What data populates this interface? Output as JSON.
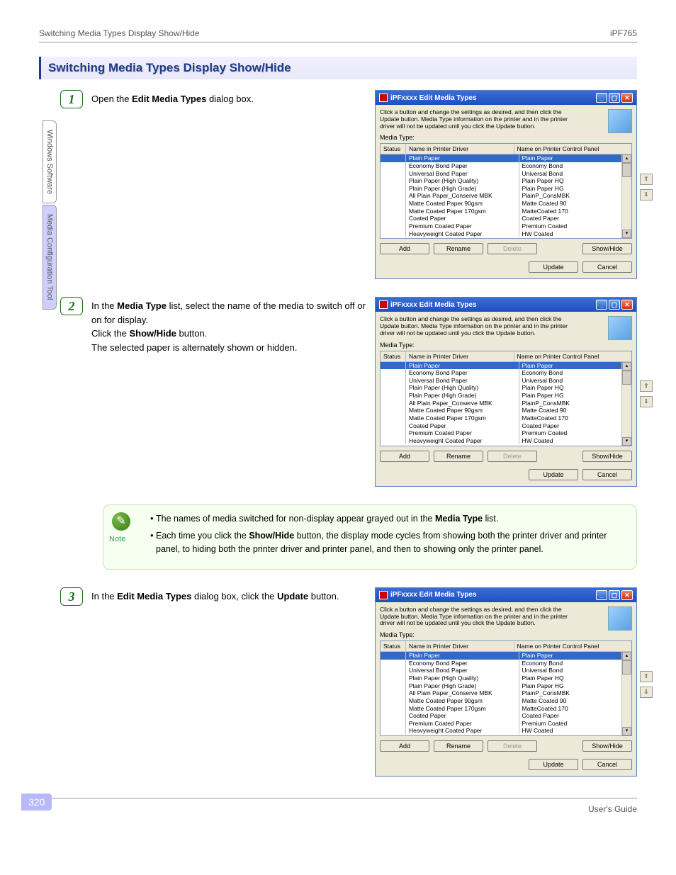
{
  "header": {
    "left": "Switching Media Types Display Show/Hide",
    "right": "iPF765"
  },
  "section_title": "Switching Media Types Display Show/Hide",
  "side_tabs": {
    "t1": "Windows Software",
    "t2": "Media Configuration Tool"
  },
  "steps": {
    "s1": {
      "num": "1",
      "text_a": "Open the ",
      "text_b": "Edit Media Types",
      "text_c": " dialog box."
    },
    "s2": {
      "num": "2",
      "line1_a": "In the ",
      "line1_b": "Media Type",
      "line1_c": " list, select the name of the media to switch off or on for display.",
      "line2_a": "Click the ",
      "line2_b": "Show/Hide",
      "line2_c": " button.",
      "line3": "The selected paper is alternately shown or hidden."
    },
    "s3": {
      "num": "3",
      "text_a": "In the ",
      "text_b": "Edit Media Types",
      "text_c": " dialog box, click the ",
      "text_d": "Update",
      "text_e": " button."
    }
  },
  "note": {
    "label": "Note",
    "li1_a": "The names of media switched for non-display appear grayed out in the ",
    "li1_b": "Media Type",
    "li1_c": " list.",
    "li2_a": "Each time you click the ",
    "li2_b": "Show/Hide",
    "li2_c": " button, the display mode cycles from showing both the printer driver and printer panel, to hiding both the printer driver and printer panel, and then to showing only the printer panel."
  },
  "dialog": {
    "title": "iPFxxxx Edit Media Types",
    "instr": "Click a button and change the settings as desired, and then click the Update button. Media Type information on the printer and in the printer driver will not be updated until you click the Update button.",
    "label": "Media Type:",
    "hdr_status": "Status",
    "hdr_driver": "Name in Printer Driver",
    "hdr_panel": "Name on Printer Control Panel",
    "rows": [
      {
        "d": "Plain Paper",
        "p": "Plain Paper",
        "sel": true
      },
      {
        "d": "Economy Bond Paper",
        "p": "Economy Bond"
      },
      {
        "d": "Universal Bond Paper",
        "p": "Universal Bond"
      },
      {
        "d": "Plain Paper (High Quality)",
        "p": "Plain Paper HQ"
      },
      {
        "d": "Plain Paper (High Grade)",
        "p": "Plain Paper HG"
      },
      {
        "d": "All Plain Paper_Conserve MBK",
        "p": "PlainP_ConsMBK"
      },
      {
        "d": "Matte Coated Paper 90gsm",
        "p": "Matte Coated 90"
      },
      {
        "d": "Matte Coated Paper 170gsm",
        "p": "MatteCoated 170"
      },
      {
        "d": "Coated Paper",
        "p": "Coated Paper"
      },
      {
        "d": "Premium Coated Paper",
        "p": "Premium Coated"
      },
      {
        "d": "Heavyweight Coated Paper",
        "p": "HW Coated"
      }
    ],
    "btn_add": "Add",
    "btn_rename": "Rename",
    "btn_delete": "Delete",
    "btn_showhide": "Show/Hide",
    "btn_update": "Update",
    "btn_cancel": "Cancel"
  },
  "page_number": "320",
  "footer": "User's Guide"
}
